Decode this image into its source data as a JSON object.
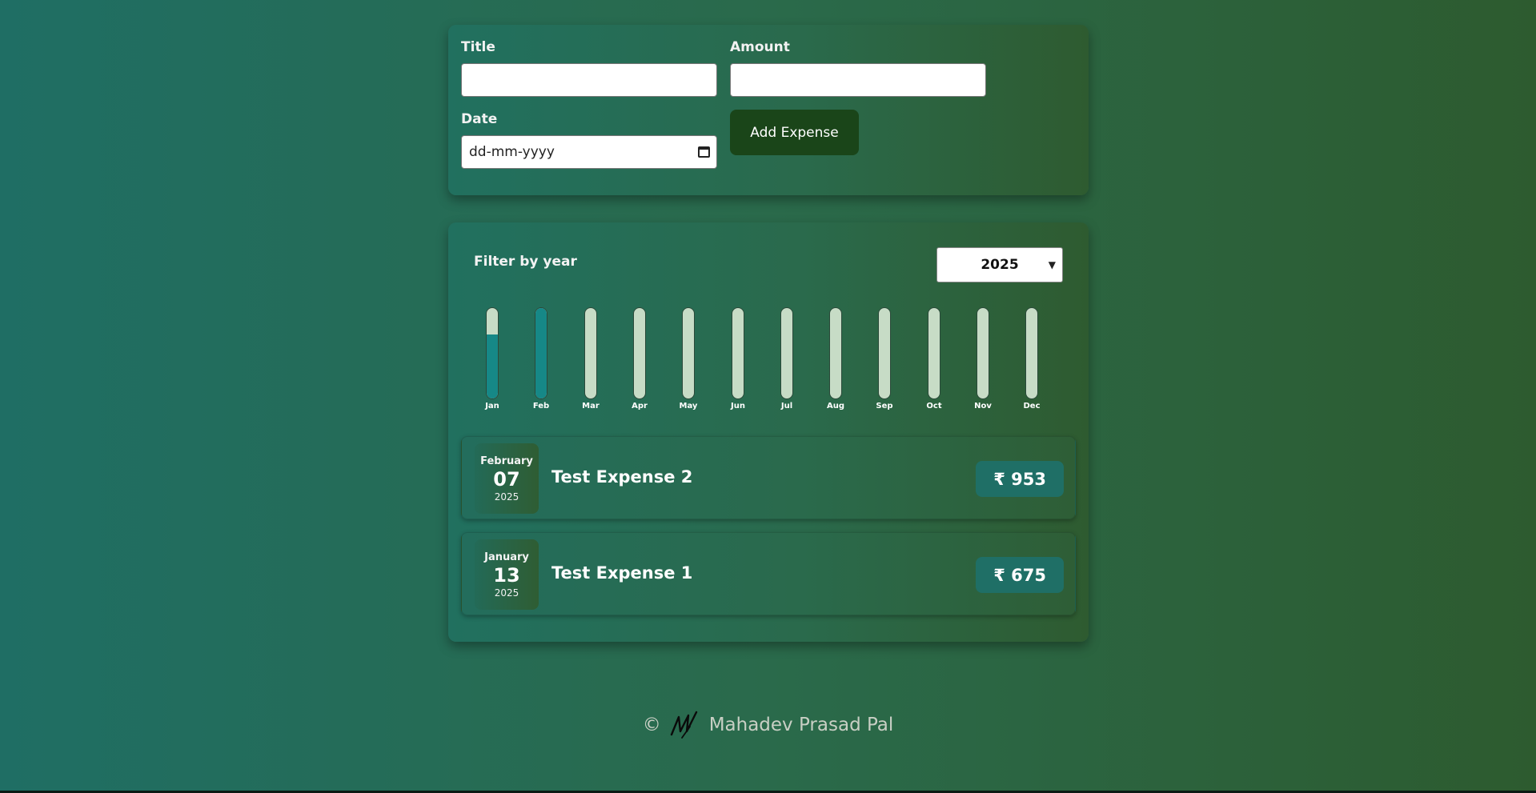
{
  "form": {
    "title_label": "Title",
    "title_value": "",
    "amount_label": "Amount",
    "amount_value": "",
    "date_label": "Date",
    "date_placeholder": "dd-mm-yyyy",
    "add_button": "Add Expense"
  },
  "filter": {
    "label": "Filter by year",
    "selected_year": "2025"
  },
  "chart_data": {
    "type": "bar",
    "categories": [
      "Jan",
      "Feb",
      "Mar",
      "Apr",
      "May",
      "Jun",
      "Jul",
      "Aug",
      "Sep",
      "Oct",
      "Nov",
      "Dec"
    ],
    "values": [
      675,
      953,
      0,
      0,
      0,
      0,
      0,
      0,
      0,
      0,
      0,
      0
    ],
    "ylim": [
      0,
      953
    ],
    "title": "",
    "xlabel": "",
    "ylabel": "",
    "colors": {
      "fill": "#168887",
      "track": "#c7dcc6"
    }
  },
  "expenses": [
    {
      "month": "February",
      "day": "07",
      "year": "2025",
      "title": "Test Expense 2",
      "amount": "₹ 953"
    },
    {
      "month": "January",
      "day": "13",
      "year": "2025",
      "title": "Test Expense 1",
      "amount": "₹ 675"
    }
  ],
  "footer": {
    "copyright": "©",
    "author": "Mahadev Prasad Pal",
    "signature_icon": "signature-icon"
  }
}
